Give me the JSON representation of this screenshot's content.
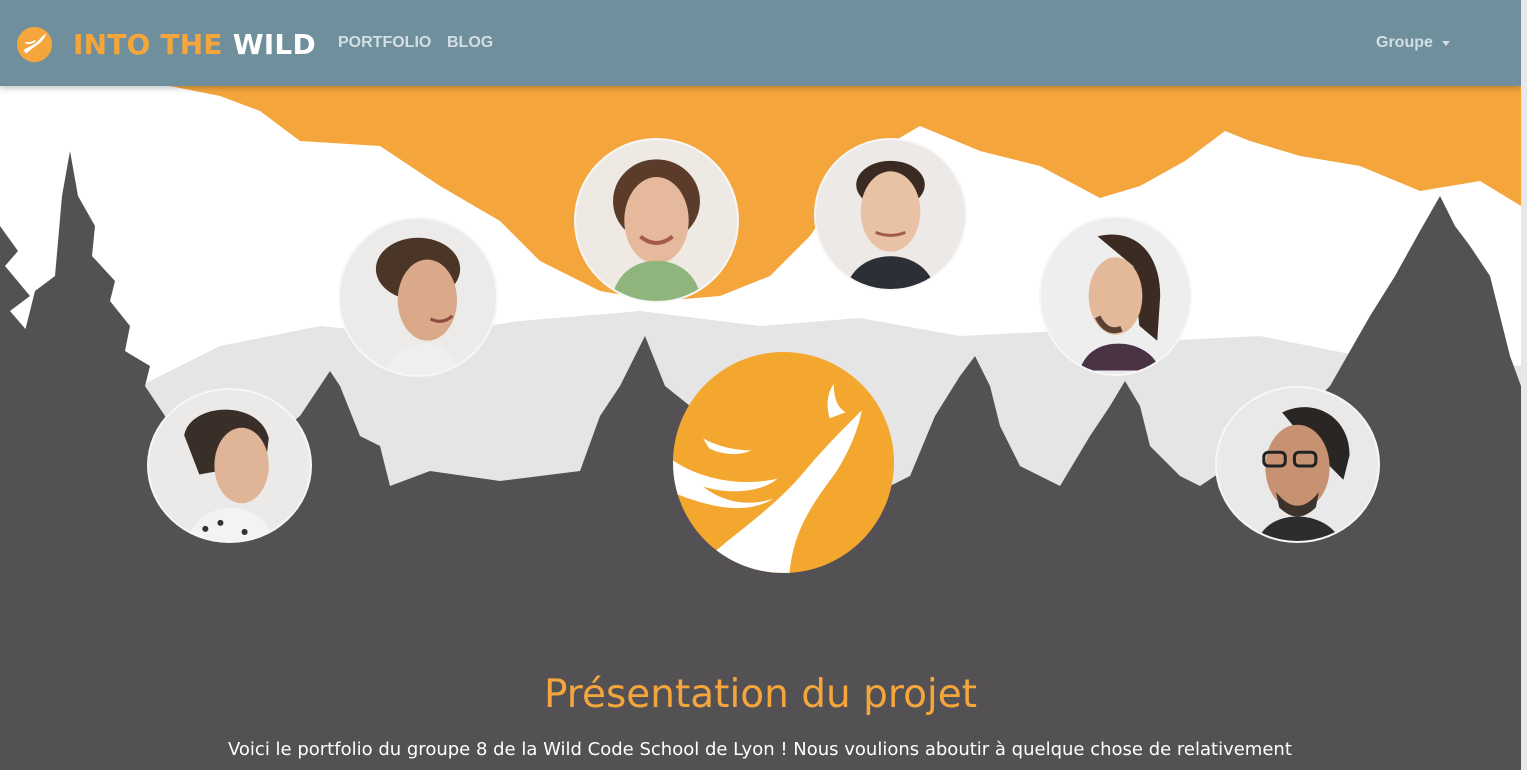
{
  "navbar": {
    "brand_into": "INTO THE",
    "brand_wild": "WILD",
    "links": [
      "PORTFOLIO",
      "BLOG"
    ],
    "dropdown_label": "Groupe",
    "background": "#6e8f9b",
    "accent": "#f4a63d"
  },
  "hero": {
    "sky_color": "#f4a63d",
    "snow_color": "#ffffff",
    "forest_color": "#535153",
    "members": [
      {
        "name": "member-1",
        "hair": "#5b3b2a",
        "skin": "#e6b89c"
      },
      {
        "name": "member-2",
        "hair": "#3a2a22",
        "skin": "#e9c1a4"
      },
      {
        "name": "member-3",
        "hair": "#4a3527",
        "skin": "#d9a98a"
      },
      {
        "name": "member-4",
        "hair": "#3b2b22",
        "skin": "#e3b99a"
      },
      {
        "name": "member-5",
        "hair": "#3a2f28",
        "skin": "#e0b497"
      },
      {
        "name": "member-6",
        "hair": "#2a2623",
        "skin": "#c79272"
      }
    ]
  },
  "content": {
    "title": "Présentation du projet",
    "intro": "Voici le portfolio du groupe 8 de la Wild Code School de Lyon ! Nous voulions aboutir à quelque chose de relativement"
  }
}
